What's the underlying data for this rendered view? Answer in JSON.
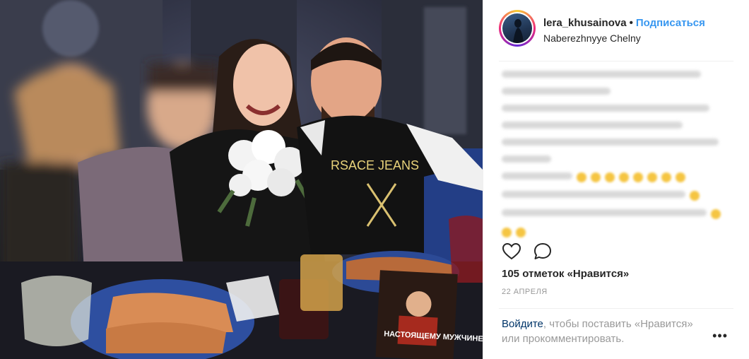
{
  "photo": {
    "alt_label": "",
    "sign_text_1": "RSACE JEANS",
    "book_title": "НАСТОЯЩЕМУ МУЖЧИНЕ"
  },
  "header": {
    "username": "lera_khusainova",
    "separator": "•",
    "follow_label": "Подписаться",
    "location": "Naberezhnyye Chelny"
  },
  "caption": {
    "blurred": true
  },
  "actions": {
    "like_icon": "heart-icon",
    "comment_icon": "comment-icon"
  },
  "likes": "105 отметок «Нравится»",
  "date": "22 АПРЕЛЯ",
  "login": {
    "link": "Войдите",
    "text": ", чтобы поставить «Нравится» или прокомментировать."
  },
  "more_label": "•••"
}
